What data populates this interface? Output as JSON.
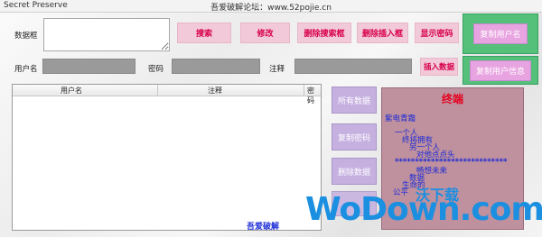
{
  "window": {
    "app_name": "Secret Preserve",
    "title": "吾爱破解论坛：www.52pojie.cn"
  },
  "form": {
    "data_box_label": "数据框",
    "data_box_value": "",
    "username_label": "用户名",
    "password_label": "密码",
    "note_label": "注释"
  },
  "buttons": {
    "search": "搜索",
    "modify": "修改",
    "delete_search_box": "删除搜索框",
    "delete_insert_box": "删除插入框",
    "show_password": "显示密码",
    "insert_data": "插入数据",
    "copy_username": "复制用户名",
    "copy_user_info": "复制用户信息",
    "all_data": "所有数据",
    "copy_password": "复制密码",
    "delete_data": "删除数据"
  },
  "list": {
    "columns": [
      "用户名",
      "注释",
      "密码"
    ]
  },
  "panel": {
    "title": "终端",
    "lines": [
      "紫电青霜",
      "一个人",
      "终将拥有",
      "另一个人",
      "对他点点头",
      "****************************",
      "畅想未来",
      "数据",
      "生命的",
      "公平"
    ]
  },
  "watermark": {
    "name": "沃下载",
    "logo": "WoDown.com"
  },
  "footer": {
    "text": "吾爱破解"
  }
}
